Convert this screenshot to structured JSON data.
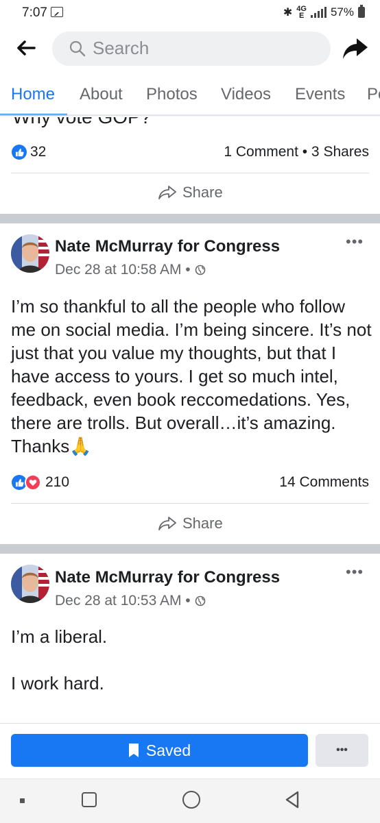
{
  "status_bar": {
    "time": "7:07",
    "network": "4G",
    "network_sub": "E",
    "battery": "57%"
  },
  "search": {
    "placeholder": "Search"
  },
  "tabs": [
    "Home",
    "About",
    "Photos",
    "Videos",
    "Events",
    "Po"
  ],
  "post1": {
    "partial_text": "Why vote GOP?",
    "reactions_count": "32",
    "comments_shares": "1 Comment • 3 Shares",
    "share_label": "Share"
  },
  "post2": {
    "author": "Nate McMurray for Congress",
    "timestamp": "Dec 28 at 10:58 AM •",
    "body": "I’m so thankful to all the people who follow me on social media. I’m being sincere. It’s not just that you value my thoughts, but that I have access to yours. I get so much intel, feedback, even book reccomedations. Yes, there are trolls. But overall…it’s amazing. Thanks🙏",
    "reactions_count": "210",
    "comments": "14 Comments",
    "share_label": "Share",
    "more_label": "•••"
  },
  "post3": {
    "author": "Nate McMurray for Congress",
    "timestamp": "Dec 28 at 10:53 AM •",
    "body_line1": "I’m a liberal.",
    "body_line2": "I work hard.",
    "more_label": "•••"
  },
  "bottom": {
    "saved_label": "Saved",
    "more_label": "•••"
  },
  "colors": {
    "accent": "#1877f2",
    "love": "#f33e58",
    "separator": "#c9ccd1"
  }
}
